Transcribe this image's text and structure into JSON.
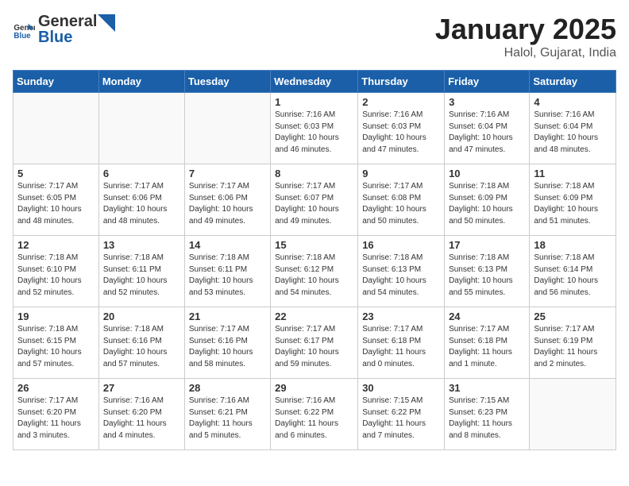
{
  "header": {
    "logo_general": "General",
    "logo_blue": "Blue",
    "title": "January 2025",
    "subtitle": "Halol, Gujarat, India"
  },
  "weekdays": [
    "Sunday",
    "Monday",
    "Tuesday",
    "Wednesday",
    "Thursday",
    "Friday",
    "Saturday"
  ],
  "weeks": [
    [
      {
        "day": "",
        "info": ""
      },
      {
        "day": "",
        "info": ""
      },
      {
        "day": "",
        "info": ""
      },
      {
        "day": "1",
        "info": "Sunrise: 7:16 AM\nSunset: 6:03 PM\nDaylight: 10 hours\nand 46 minutes."
      },
      {
        "day": "2",
        "info": "Sunrise: 7:16 AM\nSunset: 6:03 PM\nDaylight: 10 hours\nand 47 minutes."
      },
      {
        "day": "3",
        "info": "Sunrise: 7:16 AM\nSunset: 6:04 PM\nDaylight: 10 hours\nand 47 minutes."
      },
      {
        "day": "4",
        "info": "Sunrise: 7:16 AM\nSunset: 6:04 PM\nDaylight: 10 hours\nand 48 minutes."
      }
    ],
    [
      {
        "day": "5",
        "info": "Sunrise: 7:17 AM\nSunset: 6:05 PM\nDaylight: 10 hours\nand 48 minutes."
      },
      {
        "day": "6",
        "info": "Sunrise: 7:17 AM\nSunset: 6:06 PM\nDaylight: 10 hours\nand 48 minutes."
      },
      {
        "day": "7",
        "info": "Sunrise: 7:17 AM\nSunset: 6:06 PM\nDaylight: 10 hours\nand 49 minutes."
      },
      {
        "day": "8",
        "info": "Sunrise: 7:17 AM\nSunset: 6:07 PM\nDaylight: 10 hours\nand 49 minutes."
      },
      {
        "day": "9",
        "info": "Sunrise: 7:17 AM\nSunset: 6:08 PM\nDaylight: 10 hours\nand 50 minutes."
      },
      {
        "day": "10",
        "info": "Sunrise: 7:18 AM\nSunset: 6:09 PM\nDaylight: 10 hours\nand 50 minutes."
      },
      {
        "day": "11",
        "info": "Sunrise: 7:18 AM\nSunset: 6:09 PM\nDaylight: 10 hours\nand 51 minutes."
      }
    ],
    [
      {
        "day": "12",
        "info": "Sunrise: 7:18 AM\nSunset: 6:10 PM\nDaylight: 10 hours\nand 52 minutes."
      },
      {
        "day": "13",
        "info": "Sunrise: 7:18 AM\nSunset: 6:11 PM\nDaylight: 10 hours\nand 52 minutes."
      },
      {
        "day": "14",
        "info": "Sunrise: 7:18 AM\nSunset: 6:11 PM\nDaylight: 10 hours\nand 53 minutes."
      },
      {
        "day": "15",
        "info": "Sunrise: 7:18 AM\nSunset: 6:12 PM\nDaylight: 10 hours\nand 54 minutes."
      },
      {
        "day": "16",
        "info": "Sunrise: 7:18 AM\nSunset: 6:13 PM\nDaylight: 10 hours\nand 54 minutes."
      },
      {
        "day": "17",
        "info": "Sunrise: 7:18 AM\nSunset: 6:13 PM\nDaylight: 10 hours\nand 55 minutes."
      },
      {
        "day": "18",
        "info": "Sunrise: 7:18 AM\nSunset: 6:14 PM\nDaylight: 10 hours\nand 56 minutes."
      }
    ],
    [
      {
        "day": "19",
        "info": "Sunrise: 7:18 AM\nSunset: 6:15 PM\nDaylight: 10 hours\nand 57 minutes."
      },
      {
        "day": "20",
        "info": "Sunrise: 7:18 AM\nSunset: 6:16 PM\nDaylight: 10 hours\nand 57 minutes."
      },
      {
        "day": "21",
        "info": "Sunrise: 7:17 AM\nSunset: 6:16 PM\nDaylight: 10 hours\nand 58 minutes."
      },
      {
        "day": "22",
        "info": "Sunrise: 7:17 AM\nSunset: 6:17 PM\nDaylight: 10 hours\nand 59 minutes."
      },
      {
        "day": "23",
        "info": "Sunrise: 7:17 AM\nSunset: 6:18 PM\nDaylight: 11 hours\nand 0 minutes."
      },
      {
        "day": "24",
        "info": "Sunrise: 7:17 AM\nSunset: 6:18 PM\nDaylight: 11 hours\nand 1 minute."
      },
      {
        "day": "25",
        "info": "Sunrise: 7:17 AM\nSunset: 6:19 PM\nDaylight: 11 hours\nand 2 minutes."
      }
    ],
    [
      {
        "day": "26",
        "info": "Sunrise: 7:17 AM\nSunset: 6:20 PM\nDaylight: 11 hours\nand 3 minutes."
      },
      {
        "day": "27",
        "info": "Sunrise: 7:16 AM\nSunset: 6:20 PM\nDaylight: 11 hours\nand 4 minutes."
      },
      {
        "day": "28",
        "info": "Sunrise: 7:16 AM\nSunset: 6:21 PM\nDaylight: 11 hours\nand 5 minutes."
      },
      {
        "day": "29",
        "info": "Sunrise: 7:16 AM\nSunset: 6:22 PM\nDaylight: 11 hours\nand 6 minutes."
      },
      {
        "day": "30",
        "info": "Sunrise: 7:15 AM\nSunset: 6:22 PM\nDaylight: 11 hours\nand 7 minutes."
      },
      {
        "day": "31",
        "info": "Sunrise: 7:15 AM\nSunset: 6:23 PM\nDaylight: 11 hours\nand 8 minutes."
      },
      {
        "day": "",
        "info": ""
      }
    ]
  ]
}
